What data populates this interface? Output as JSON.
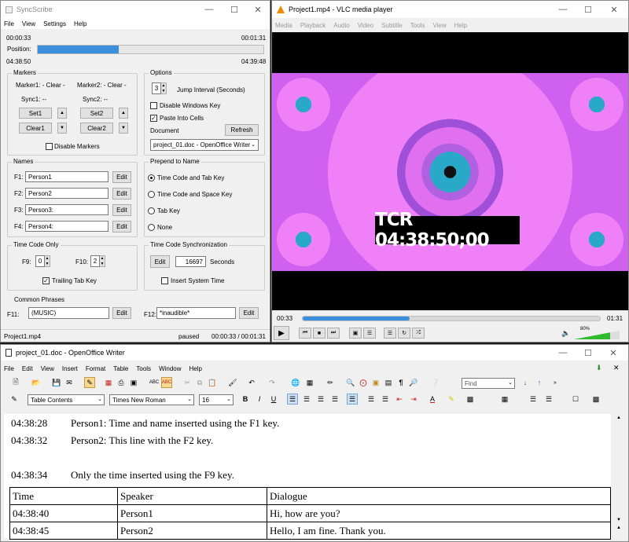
{
  "syncscribe": {
    "title": "SyncScribe",
    "menu": [
      "File",
      "View",
      "Settings",
      "Help"
    ],
    "time_start": "00:00:33",
    "time_end": "00:01:31",
    "position_label": "Position:",
    "position_fraction": 0.36,
    "pos_start": "04:38:50",
    "pos_end": "04:39:48",
    "markers": {
      "label": "Markers",
      "marker1": "Marker1: - Clear -",
      "marker2": "Marker2: - Clear -",
      "sync1": "Sync1: --",
      "sync2": "Sync2: --",
      "set_label": "Set1",
      "set2_label": "Set2",
      "clear1_label": "Clear1",
      "clear2_label": "Clear2",
      "disable_label": "Disable Markers"
    },
    "options": {
      "label": "Options",
      "jump_value": "3",
      "jump_label": "Jump Interval (Seconds)",
      "disable_win": "Disable Windows Key",
      "paste": "Paste Into Cells",
      "document_label": "Document",
      "refresh": "Refresh",
      "doc_value": "project_01.doc - OpenOffice Writer"
    },
    "names": {
      "label": "Names",
      "rows": [
        {
          "key": "F1:",
          "value": "Person1",
          "edit": "Edit"
        },
        {
          "key": "F2:",
          "value": "Person2",
          "edit": "Edit"
        },
        {
          "key": "F3:",
          "value": "Person3:",
          "edit": "Edit"
        },
        {
          "key": "F4:",
          "value": "Person4:",
          "edit": "Edit"
        }
      ]
    },
    "prepend": {
      "label": "Prepend to Name",
      "opt1": "Time Code and Tab Key",
      "opt2": "Time Code and Space Key",
      "opt3": "Tab Key",
      "opt4": "None"
    },
    "tconly": {
      "label": "Time Code Only",
      "f9": "F9:",
      "f9_val": "0",
      "f10": "F10:",
      "f10_val": "2",
      "trailing": "Trailing Tab Key"
    },
    "tcsync": {
      "label": "Time Code Synchronization",
      "edit": "Edit",
      "value": "16697",
      "seconds": "Seconds",
      "insert": "Insert System Time"
    },
    "phrases": {
      "label": "Common Phrases",
      "f11": "F11:",
      "f11_val": "(MUSIC)",
      "f12": "F12:",
      "f12_val": "*inaudible*",
      "edit": "Edit"
    },
    "status": {
      "file": "Project1.mp4",
      "state": "paused",
      "time": "00:00:33 / 00:01:31"
    }
  },
  "vlc": {
    "title": "Project1.mp4 - VLC media player",
    "menu": [
      "Media",
      "Playback",
      "Audio",
      "Video",
      "Subtitle",
      "Tools",
      "View",
      "Help"
    ],
    "overlay": "TCR 04:38:50;00",
    "time_cur": "00:33",
    "time_total": "01:31",
    "seek_fraction": 0.36,
    "volume": "80%",
    "volume_fraction": 0.8
  },
  "writer": {
    "title": "project_01.doc - OpenOffice Writer",
    "menu": [
      "File",
      "Edit",
      "View",
      "Insert",
      "Format",
      "Table",
      "Tools",
      "Window",
      "Help"
    ],
    "find_placeholder": "Find",
    "style": "Table Contents",
    "font": "Times New Roman",
    "size": "16",
    "lines": [
      {
        "time": "04:38:28",
        "text": "Person1: Time and name inserted using the F1 key."
      },
      {
        "time": "04:38:32",
        "text": "Person2: This line with the F2 key."
      },
      {
        "time": "04:38:34",
        "text": "Only the time inserted using the F9 key."
      }
    ],
    "table": {
      "headers": [
        "Time",
        "Speaker",
        "Dialogue"
      ],
      "rows": [
        [
          "04:38:40",
          "Person1",
          "Hi, how are you?"
        ],
        [
          "04:38:45",
          "Person2",
          "Hello, I am fine. Thank you."
        ]
      ]
    }
  }
}
